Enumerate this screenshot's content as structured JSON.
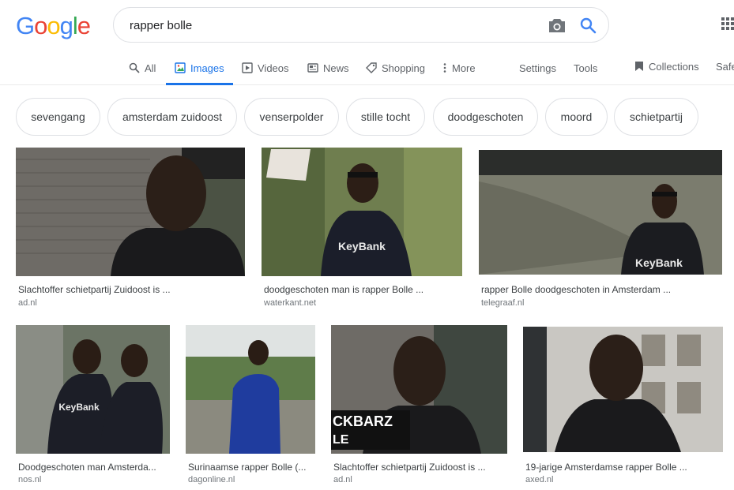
{
  "logo": {
    "text": "Google",
    "letters": [
      "G",
      "o",
      "o",
      "g",
      "l",
      "e"
    ],
    "colors": [
      "#4285f4",
      "#ea4335",
      "#fbbc05",
      "#4285f4",
      "#34a853",
      "#ea4335"
    ]
  },
  "search": {
    "query": "rapper bolle"
  },
  "tabs": {
    "all": "All",
    "images": "Images",
    "videos": "Videos",
    "news": "News",
    "shopping": "Shopping",
    "more": "More",
    "settings": "Settings",
    "tools": "Tools",
    "collections": "Collections",
    "safesearch": "Safe"
  },
  "chips": [
    "sevengang",
    "amsterdam zuidoost",
    "venserpolder",
    "stille tocht",
    "doodgeschoten",
    "moord",
    "schietpartij"
  ],
  "results": [
    {
      "caption": "Slachtoffer schietpartij Zuidoost is ...",
      "source": "ad.nl"
    },
    {
      "caption": "doodgeschoten man is rapper Bolle ...",
      "source": "waterkant.net"
    },
    {
      "caption": "rapper Bolle doodgeschoten in Amsterdam ...",
      "source": "telegraaf.nl"
    },
    {
      "caption": "Doodgeschoten man Amsterda...",
      "source": "nos.nl"
    },
    {
      "caption": "Surinaamse rapper Bolle (...",
      "source": "dagonline.nl"
    },
    {
      "caption": "Slachtoffer schietpartij Zuidoost is ...",
      "source": "ad.nl"
    },
    {
      "caption": "19-jarige Amsterdamse rapper Bolle ...",
      "source": "axed.nl"
    }
  ],
  "image_text": {
    "keybank": "KeyBank",
    "overlay_brand": "CKBARZ",
    "overlay_small": "LE"
  },
  "colors": {
    "accent": "#1a73e8",
    "muted": "#5f6368"
  }
}
